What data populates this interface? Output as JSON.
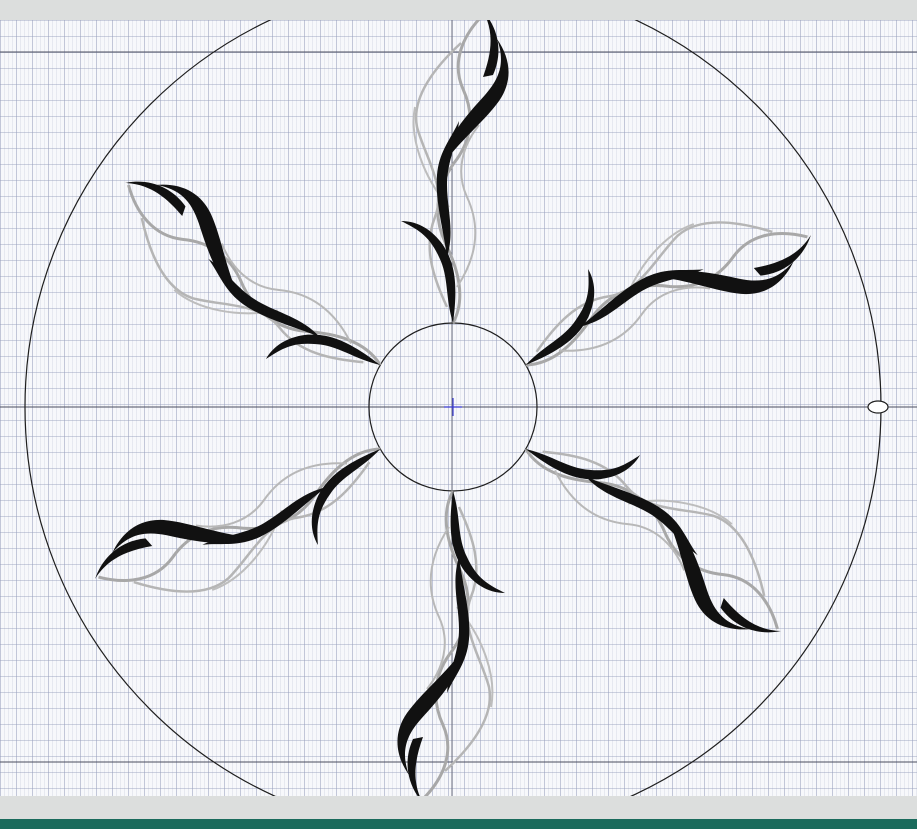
{
  "window": {
    "app": "embroidery-design-editor"
  },
  "canvas": {
    "grid": "on",
    "hoop_shape": "circle",
    "background_color": "#f7f8fb",
    "grid_color": "#969ebc"
  },
  "design": {
    "motif": "six-flame-swirl",
    "colors": {
      "primary_thread": "#111111",
      "secondary_thread": "#a8a8a8",
      "guide_lines": "#1e1e1e",
      "center_cross": "#3a3ad0"
    },
    "arm_count": 6
  },
  "status_bar": {
    "color": "#1a6b5c"
  }
}
